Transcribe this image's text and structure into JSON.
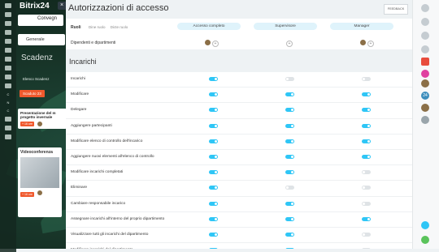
{
  "app": {
    "logo_main": "Bitrix24",
    "logo_num": "24"
  },
  "background": {
    "conversation_title": "Convegn",
    "generale_label": "Generale",
    "scadenza_title": "Scadenz",
    "tabs": "Elenco   Scadenz",
    "scadenze_badge": "Scaduto 23",
    "card1_title": "Presentazione del m progetto invernale",
    "card1_tag": "+ 16 ore",
    "card2_title": "Videoconferenza",
    "card2_tag": "+ 16 ore",
    "nav_items": [
      "C",
      "N",
      "C"
    ]
  },
  "panel": {
    "close_icon": "×",
    "title": "Autorizzazioni di accesso",
    "feedback_label": "FEEDBACK",
    "roles_label": "Ruoli",
    "role_tabs": [
      "Dine ruolo",
      "Dicte ruolo"
    ],
    "role_columns": [
      "Accesso completo",
      "Supervisore",
      "Manager"
    ],
    "departments_label": "Dipendenti e dipartimenti",
    "section_title": "Incarichi",
    "rows": [
      {
        "label": "Incarichi",
        "values": [
          true,
          false,
          false
        ]
      },
      {
        "label": "Modificare",
        "values": [
          true,
          true,
          true
        ]
      },
      {
        "label": "Delegare",
        "values": [
          true,
          true,
          true
        ]
      },
      {
        "label": "Aggiungere partecipanti",
        "values": [
          true,
          true,
          true
        ]
      },
      {
        "label": "Modificare elenco di controllo dell'incarico",
        "values": [
          true,
          true,
          true
        ]
      },
      {
        "label": "Aggiungere nuovi elementi all'elenco di controllo",
        "values": [
          true,
          true,
          true
        ]
      },
      {
        "label": "Modificare incarichi completati",
        "values": [
          true,
          true,
          false
        ]
      },
      {
        "label": "Eliminare",
        "values": [
          true,
          false,
          false
        ]
      },
      {
        "label": "Cambiare responsabile incarico",
        "values": [
          true,
          true,
          false
        ]
      },
      {
        "label": "Assegnare incarichi all'interno del proprio dipartimento",
        "values": [
          true,
          true,
          true
        ]
      },
      {
        "label": "Visualizzare tutti gli incarichi del dipartimento",
        "values": [
          true,
          true,
          false
        ]
      },
      {
        "label": "Modificare incarichi del dipartimento",
        "values": [
          true,
          true,
          false
        ]
      }
    ]
  },
  "colors": {
    "toggle_on": "#2fc6f6",
    "toggle_off": "#dfe3e6",
    "pill": "#dff3fb",
    "badge": "#f0592d"
  }
}
